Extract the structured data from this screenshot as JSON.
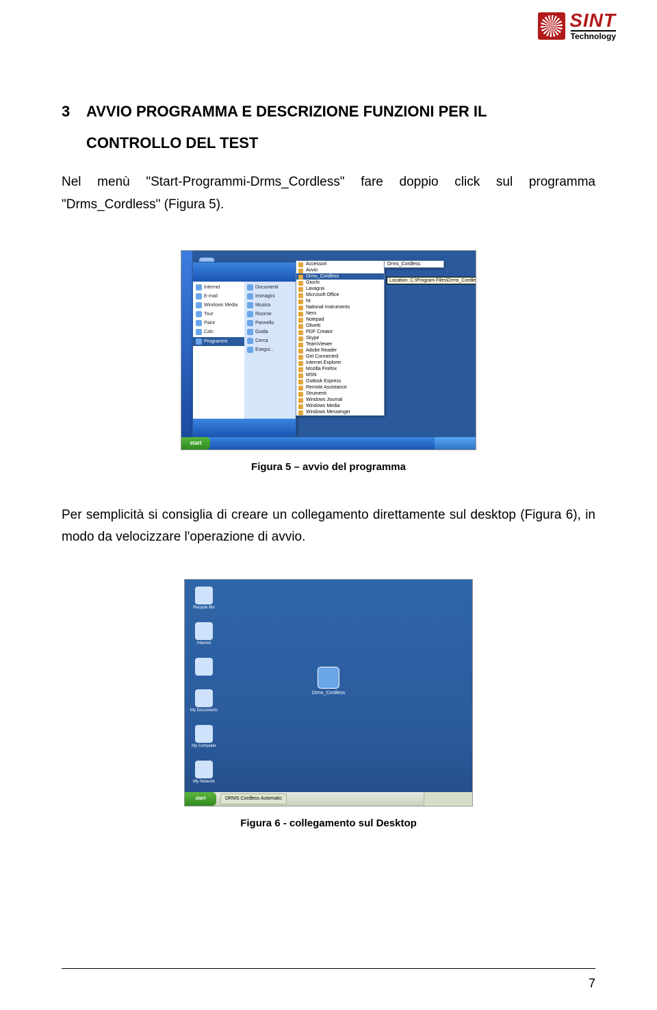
{
  "logo": {
    "brand": "SINT",
    "sub": "Technology"
  },
  "heading": {
    "num": "3",
    "line1": "AVVIO PROGRAMMA E DESCRIZIONE FUNZIONI PER IL",
    "line2": "CONTROLLO DEL TEST"
  },
  "para1": "Nel menù \"Start-Programmi-Drms_Cordless\" fare doppio click sul programma \"Drms_Cordless\" (Figura 5).",
  "fig5": {
    "caption": "Figura 5 – avvio del programma",
    "start": "start",
    "left_items": [
      "Internet",
      "E-mail",
      "Windows Media",
      "Tour",
      "Paint",
      "Calc"
    ],
    "programmi": "Programmi",
    "right_items": [
      "Documenti",
      "Immagini",
      "Musica",
      "Risorse",
      "Pannello",
      "Guida",
      "Cerca",
      "Esegui..."
    ],
    "submenu": [
      "Accessori",
      "Avvio",
      "Drms_Cordless",
      "Giochi",
      "Lavagna",
      "Microsoft Office",
      "NI",
      "National Instruments",
      "Nero",
      "Notepad",
      "Olivetti",
      "PDF Creator",
      "Skype",
      "TeamViewer",
      "Adobe Reader",
      "Get Connected",
      "Internet Explorer",
      "Mozilla Firefox",
      "MSN",
      "Outlook Express",
      "Remote Assistance",
      "Strumenti",
      "Windows Journal",
      "Windows Media",
      "Windows Messenger"
    ],
    "submenu_hl": "Drms_Cordless",
    "submenu2": "Drms_Cordless",
    "tooltip": "Location: C:\\Program Files\\Drms_Cordless"
  },
  "para2": "Per semplicità si consiglia di creare un collegamento direttamente sul desktop (Figura 6), in modo da velocizzare l'operazione di avvio.",
  "fig6": {
    "caption": "Figura 6 - collegamento sul Desktop",
    "center_label": "Drms_Cordless",
    "icons": [
      "Recycle Bin",
      "Internet",
      "",
      "My Documents",
      "My Computer",
      "My Network",
      "DRMS Cordless"
    ],
    "start": "start",
    "taskbtn": "DRMS Cordless Automatic"
  },
  "page_number": "7"
}
